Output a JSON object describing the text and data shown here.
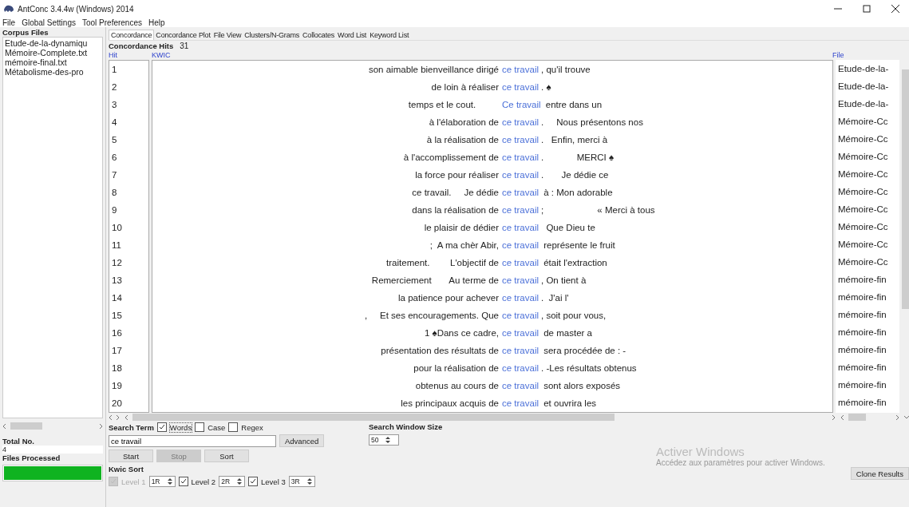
{
  "window": {
    "title": "AntConc 3.4.4w (Windows) 2014"
  },
  "menu": [
    "File",
    "Global Settings",
    "Tool Preferences",
    "Help"
  ],
  "corpus_files": {
    "title": "Corpus Files",
    "items": [
      "Etude-de-la-dynamiqu",
      "Mémoire-Complete.txt",
      "mémoire-final.txt",
      "Métabolisme-des-pro"
    ],
    "total_label": "Total No.",
    "total": "4",
    "processed_label": "Files Processed",
    "progress": {
      "level": 1
    }
  },
  "tabs": [
    {
      "label": "Concordance",
      "selected": true
    },
    {
      "label": "Concordance Plot",
      "selected": false
    },
    {
      "label": "File View",
      "selected": false
    },
    {
      "label": "Clusters/N-Grams",
      "selected": false
    },
    {
      "label": "Collocates",
      "selected": false
    },
    {
      "label": "Word List",
      "selected": false
    },
    {
      "label": "Keyword List",
      "selected": false
    }
  ],
  "hits": {
    "label": "Concordance Hits",
    "count": "31"
  },
  "table": {
    "columns": [
      "Hit",
      "KWIC",
      "File"
    ],
    "rows": [
      {
        "hit": "1",
        "left": "son aimable bienveillance dirigé",
        "key": "ce travail",
        "right": ", qu'il trouve",
        "file": "Etude-de-la-"
      },
      {
        "hit": "2",
        "left": "de loin à réaliser",
        "key": "ce travail",
        "right": ". ♠",
        "file": "Etude-de-la-"
      },
      {
        "hit": "3",
        "left": "temps et le cout.         ",
        "key": "Ce travail",
        "right": " entre dans un",
        "file": "Etude-de-la-"
      },
      {
        "hit": "4",
        "left": "à l'élaboration de",
        "key": "ce travail",
        "right": ".     Nous présentons nos",
        "file": "Mémoire-Cc"
      },
      {
        "hit": "5",
        "left": "à la réalisation de",
        "key": "ce travail",
        "right": ".   Enfin, merci à",
        "file": "Mémoire-Cc"
      },
      {
        "hit": "6",
        "left": "à l'accomplissement de",
        "key": "ce travail",
        "right": ".             MERCI ♠",
        "file": "Mémoire-Cc"
      },
      {
        "hit": "7",
        "left": "la force pour réaliser",
        "key": "ce travail",
        "right": ".       Je dédie ce",
        "file": "Mémoire-Cc"
      },
      {
        "hit": "8",
        "left": "ce travail.     Je dédie",
        "key": "ce travail",
        "right": " à : Mon adorable",
        "file": "Mémoire-Cc"
      },
      {
        "hit": "9",
        "left": "dans la réalisation de",
        "key": "ce travail",
        "right": ";                     « Merci à tous",
        "file": "Mémoire-Cc"
      },
      {
        "hit": "10",
        "left": "le plaisir de dédier",
        "key": "ce travail",
        "right": "  Que Dieu te",
        "file": "Mémoire-Cc"
      },
      {
        "hit": "11",
        "left": ";  A ma chèr Abir,",
        "key": "ce travail",
        "right": " représente le fruit",
        "file": "Mémoire-Cc"
      },
      {
        "hit": "12",
        "left": "traitement.        L'objectif de",
        "key": "ce travail",
        "right": " était l'extraction",
        "file": "Mémoire-Cc"
      },
      {
        "hit": "13",
        "left": "Remerciement       Au terme de",
        "key": "ce travail",
        "right": ", On tient à",
        "file": "mémoire-fin"
      },
      {
        "hit": "14",
        "left": "la patience pour achever",
        "key": "ce travail",
        "right": ".  J'ai l'",
        "file": "mémoire-fin"
      },
      {
        "hit": "15",
        "left": ",     Et ses encouragements. Que",
        "key": "ce travail",
        "right": ", soit pour vous,",
        "file": "mémoire-fin"
      },
      {
        "hit": "16",
        "left": "1 ♠Dans ce cadre,",
        "key": "ce travail",
        "right": " de master a",
        "file": "mémoire-fin"
      },
      {
        "hit": "17",
        "left": "présentation des résultats de",
        "key": "ce travail",
        "right": " sera procédée de : -",
        "file": "mémoire-fin"
      },
      {
        "hit": "18",
        "left": "pour la réalisation de",
        "key": "ce travail",
        "right": ". -Les résultats obtenus",
        "file": "mémoire-fin"
      },
      {
        "hit": "19",
        "left": "obtenus au cours de",
        "key": "ce travail",
        "right": " sont alors exposés",
        "file": "mémoire-fin"
      },
      {
        "hit": "20",
        "left": "les principaux acquis de",
        "key": "ce travail",
        "right": " et ouvrira les",
        "file": "mémoire-fin"
      }
    ]
  },
  "search": {
    "label": "Search Term",
    "options": [
      {
        "label": "Words",
        "checked": true
      },
      {
        "label": "Case",
        "checked": false
      },
      {
        "label": "Regex",
        "checked": false
      }
    ],
    "value": "ce travail",
    "advanced": "Advanced",
    "window_label": "Search Window Size",
    "window_size": "50"
  },
  "buttons": [
    {
      "label": "Start",
      "disabled": false
    },
    {
      "label": "Stop",
      "disabled": true
    },
    {
      "label": "Sort",
      "disabled": false
    }
  ],
  "kwic_sort": {
    "label": "Kwic Sort",
    "levels": [
      {
        "label": "Level 1",
        "value": "1R",
        "checked": true,
        "disabled": true
      },
      {
        "label": "Level 2",
        "value": "2R",
        "checked": true,
        "disabled": false
      },
      {
        "label": "Level 3",
        "value": "3R",
        "checked": true,
        "disabled": false
      }
    ]
  },
  "activation": {
    "title": "Activer Windows",
    "text": "Accédez aux paramètres pour activer Windows."
  },
  "clone": "Clone Results"
}
